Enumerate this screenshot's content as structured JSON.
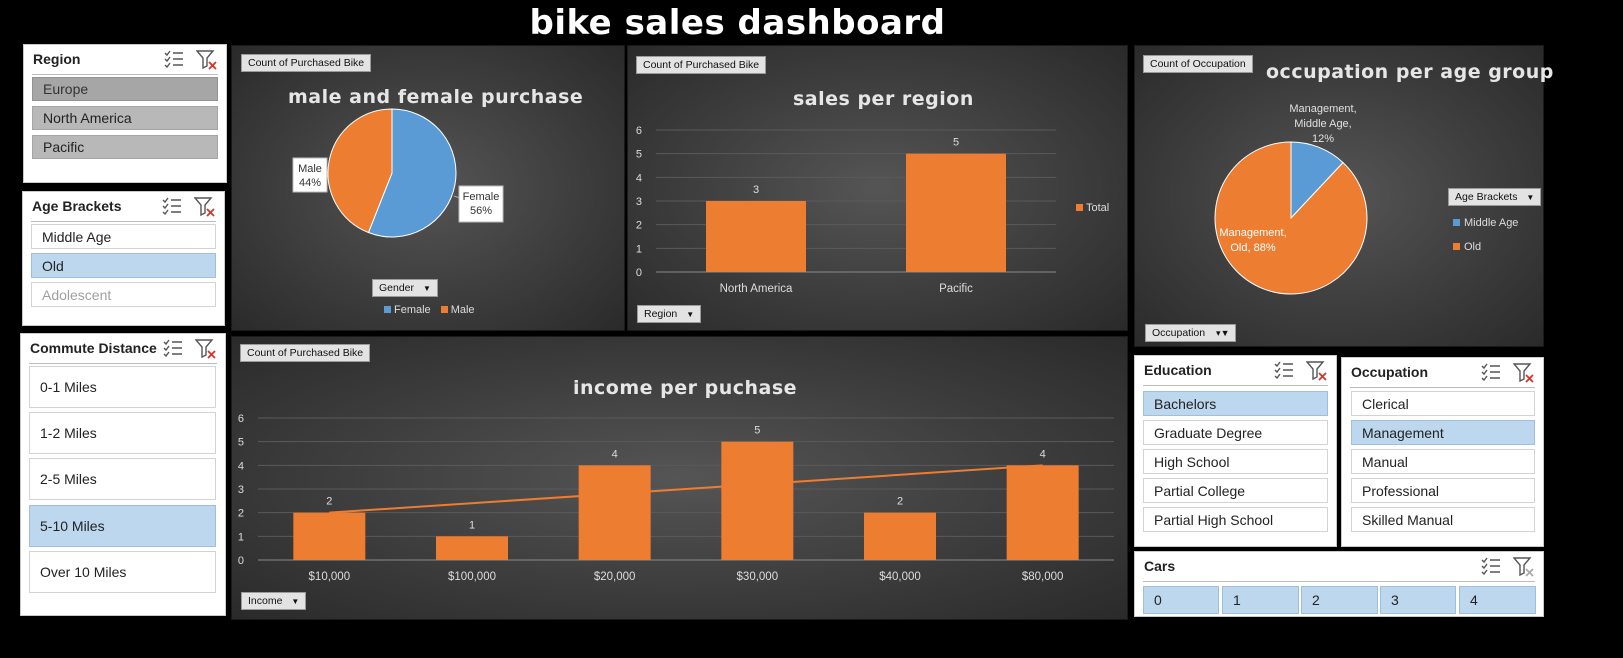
{
  "dashboard": {
    "title": "bike sales dashboard"
  },
  "colors": {
    "orange": "#ed7d31",
    "blue": "#5b9bd5",
    "selected": "#bdd7ee",
    "background": "#000000"
  },
  "icons": {
    "multi_select": "multi-select-icon",
    "clear_filter": "clear-filter-icon",
    "dropdown": "dropdown-arrow-icon"
  },
  "slicers": {
    "region": {
      "title": "Region",
      "items": [
        "Europe",
        "North America",
        "Pacific"
      ]
    },
    "age_brackets": {
      "title": "Age Brackets",
      "items": [
        "Middle Age",
        "Old",
        "Adolescent"
      ]
    },
    "commute_distance": {
      "title": "Commute Distance",
      "items": [
        "0-1 Miles",
        "1-2 Miles",
        "2-5 Miles",
        "5-10 Miles",
        "Over 10 Miles"
      ]
    },
    "education": {
      "title": "Education",
      "items": [
        "Bachelors",
        "Graduate Degree",
        "High School",
        "Partial College",
        "Partial High School"
      ]
    },
    "occupation": {
      "title": "Occupation",
      "items": [
        "Clerical",
        "Management",
        "Manual",
        "Professional",
        "Skilled Manual"
      ]
    },
    "cars": {
      "title": "Cars",
      "items": [
        "0",
        "1",
        "2",
        "3",
        "4"
      ]
    }
  },
  "charts": {
    "gender": {
      "value_button": "Count of Purchased Bike",
      "axis_button": "Gender",
      "legend": [
        "Female",
        "Male"
      ]
    },
    "region": {
      "value_button": "Count of Purchased Bike",
      "axis_button": "Region",
      "legend": "Total"
    },
    "occupation": {
      "value_button": "Count of Occupation",
      "axis_button": "Occupation",
      "legend_button": "Age Brackets",
      "legend": [
        "Middle Age",
        "Old"
      ]
    },
    "income": {
      "value_button": "Count of Purchased Bike",
      "axis_button": "Income"
    }
  },
  "chart_data": [
    {
      "type": "pie",
      "title": "male and female purchase",
      "categories": [
        "Female",
        "Male"
      ],
      "values": [
        56,
        44
      ],
      "labels": [
        "Female\n56%",
        "Male\n44%"
      ],
      "colors": [
        "#5b9bd5",
        "#ed7d31"
      ],
      "legend": "bottom"
    },
    {
      "type": "bar",
      "title": "sales per region",
      "categories": [
        "North America",
        "Pacific"
      ],
      "series": [
        {
          "name": "Total",
          "values": [
            3,
            5
          ]
        }
      ],
      "ylim": [
        0,
        6
      ],
      "yticks": [
        0,
        1,
        2,
        3,
        4,
        5,
        6
      ],
      "grid": true,
      "legend": "right"
    },
    {
      "type": "pie",
      "title": "occupation per age group",
      "categories": [
        "Middle Age",
        "Old"
      ],
      "values": [
        12,
        88
      ],
      "labels": [
        "Management, Middle Age, 12%",
        "Management, Old, 88%"
      ],
      "colors": [
        "#5b9bd5",
        "#ed7d31"
      ],
      "legend": "right"
    },
    {
      "type": "bar",
      "title": "income per puchase",
      "categories": [
        "$10,000",
        "$100,000",
        "$20,000",
        "$30,000",
        "$40,000",
        "$80,000"
      ],
      "series": [
        {
          "values": [
            2,
            1,
            4,
            5,
            2,
            4
          ]
        }
      ],
      "trendline": "linear",
      "ylim": [
        0,
        6
      ],
      "yticks": [
        0,
        1,
        2,
        3,
        4,
        5,
        6
      ],
      "grid": true
    }
  ]
}
